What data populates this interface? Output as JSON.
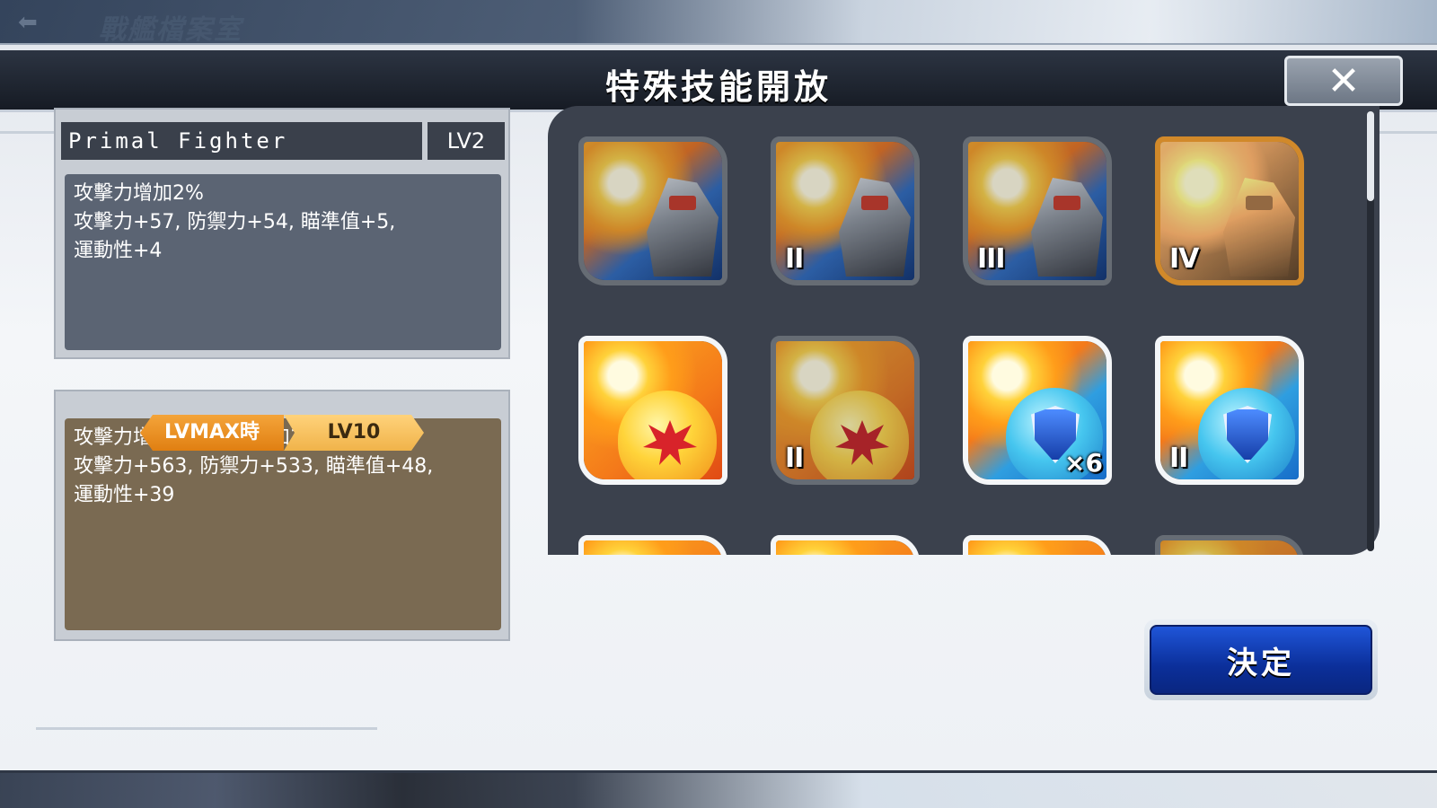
{
  "background": {
    "screen_title": "戰艦檔案室",
    "back_icon": "back-arrow-icon"
  },
  "dialog": {
    "title": "特殊技能開放",
    "close_icon": "close-icon",
    "close_glyph": "✕"
  },
  "current_skill": {
    "name": "Primal Fighter",
    "level": "LV2",
    "description_lines": [
      "攻擊力增加2%",
      "攻擊力+57, 防禦力+54, 瞄準值+5,",
      "運動性+4"
    ]
  },
  "max_skill": {
    "tab_label": "LVMAX時",
    "level": "LV10",
    "description_lines": [
      "攻擊力增加5%、HP增加15000",
      "攻擊力+563, 防禦力+533, 瞄準值+48,",
      "運動性+39"
    ]
  },
  "skill_icons": [
    {
      "art": "fighter",
      "state": "dim",
      "numeral": "",
      "count": ""
    },
    {
      "art": "fighter",
      "state": "dim",
      "numeral": "II",
      "count": ""
    },
    {
      "art": "fighter",
      "state": "dim",
      "numeral": "III",
      "count": ""
    },
    {
      "art": "fighter",
      "state": "locked",
      "numeral": "IV",
      "count": ""
    },
    {
      "art": "egg",
      "state": "bright",
      "numeral": "",
      "count": ""
    },
    {
      "art": "egg",
      "state": "dim",
      "numeral": "II",
      "count": ""
    },
    {
      "art": "shield",
      "state": "bright",
      "numeral": "",
      "count": "×6"
    },
    {
      "art": "shield",
      "state": "bright",
      "numeral": "II",
      "count": ""
    }
  ],
  "confirm_button": {
    "label": "決定"
  },
  "colors": {
    "accent_blue": "#1f55d8",
    "orange_tab": "#e07f12",
    "panel_dark": "#3b414d"
  }
}
